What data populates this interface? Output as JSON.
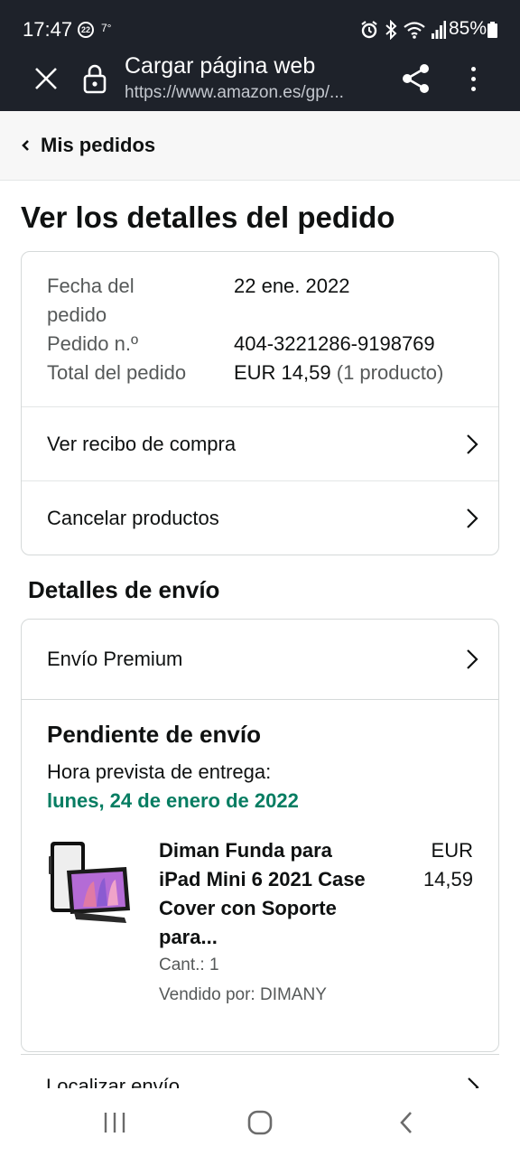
{
  "status_bar": {
    "time": "17:47",
    "notification_badge": "22",
    "temperature": "7°",
    "battery": "85%",
    "icons": [
      "alarm-icon",
      "bluetooth-icon",
      "wifi-icon",
      "signal-icon",
      "battery-icon"
    ]
  },
  "browser": {
    "title": "Cargar página web",
    "url": "https://www.amazon.es/gp/...",
    "icons": [
      "close-icon",
      "lock-icon",
      "share-icon",
      "more-vert-icon"
    ]
  },
  "breadcrumb": {
    "label": "Mis pedidos"
  },
  "page": {
    "title": "Ver los detalles del pedido"
  },
  "summary": {
    "order_date_label": "Fecha del pedido",
    "order_date_value": "22 ene. 2022",
    "order_number_label": "Pedido n.º",
    "order_number_value": "404-3221286-9198769",
    "order_total_label": "Total del pedido",
    "order_total_value": "EUR 14,59",
    "order_total_count": "(1 producto)",
    "view_receipt": "Ver recibo de compra",
    "cancel_items": "Cancelar productos"
  },
  "shipping": {
    "section_title": "Detalles de envío",
    "shipping_method": "Envío Premium",
    "status": "Pendiente de envío",
    "eta_label": "Hora prevista de entrega:",
    "eta_date": "lunes, 24 de enero de 2022",
    "product": {
      "title": "Diman Funda para iPad Mini 6 2021 Case Cover con Soporte para...",
      "price": "EUR 14,59",
      "quantity": "Cant.: 1",
      "seller": "Vendido por: DIMANY"
    },
    "track_label": "Localizar envío"
  },
  "nav": {
    "icons": [
      "recent-apps-icon",
      "home-icon",
      "back-icon"
    ]
  }
}
